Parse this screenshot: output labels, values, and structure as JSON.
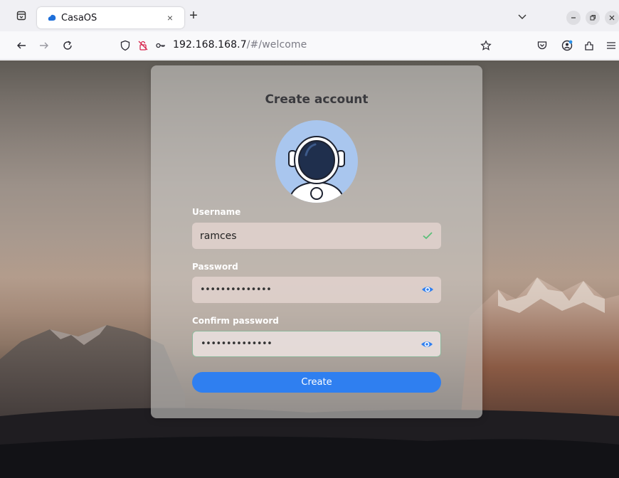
{
  "browser": {
    "tab": {
      "title": "CasaOS",
      "favicon": "casaos-cloud-icon",
      "close_glyph": "×"
    },
    "new_tab_glyph": "+",
    "url": {
      "host": "192.168.168.7",
      "path": "/#/welcome"
    },
    "icons": [
      "tab-list-icon",
      "back-icon",
      "forward-icon",
      "reload-icon",
      "shield-icon",
      "permissions-icon",
      "key-icon",
      "bookmark-star-icon",
      "pocket-icon",
      "account-icon",
      "extensions-icon",
      "menu-icon",
      "minimize-icon",
      "restore-icon",
      "close-window-icon"
    ]
  },
  "page": {
    "title": "Create account",
    "username": {
      "label": "Username",
      "value": "ramces",
      "status_icon": "check-icon"
    },
    "password": {
      "label": "Password",
      "masked_value": "••••••••••••••",
      "toggle_icon": "eye-icon"
    },
    "confirm_password": {
      "label": "Confirm password",
      "masked_value": "••••••••••••••",
      "toggle_icon": "eye-icon"
    },
    "create_button": "Create"
  },
  "colors": {
    "accent": "#2f7ff0",
    "valid": "#5cbf7a",
    "avatar_bg": "#a9c6ee"
  }
}
